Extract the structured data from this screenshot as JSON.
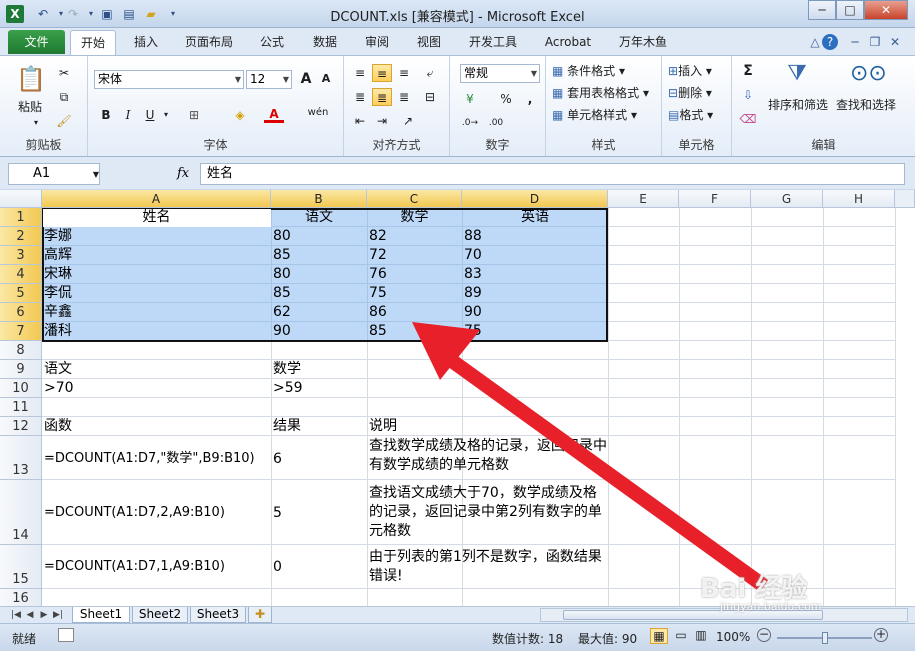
{
  "window": {
    "title": "DCOUNT.xls  [兼容模式] - Microsoft Excel",
    "app_icon": "X",
    "controls": [
      "─",
      "□",
      "✕"
    ],
    "doc_controls": [
      "△",
      "?",
      "─",
      "❐",
      "✕"
    ]
  },
  "ribbon_tabs": {
    "file": "文件",
    "tabs": [
      "开始",
      "插入",
      "页面布局",
      "公式",
      "数据",
      "审阅",
      "视图",
      "开发工具",
      "Acrobat",
      "万年木鱼"
    ],
    "active": "开始"
  },
  "ribbon": {
    "clipboard": {
      "label": "剪贴板",
      "paste": "粘贴"
    },
    "font": {
      "label": "字体",
      "font_name": "宋体",
      "font_size": "12",
      "bold": "B",
      "italic": "I",
      "underline": "U",
      "grow": "A",
      "shrink": "A",
      "wen": "wén",
      "font_color": "A"
    },
    "alignment": {
      "label": "对齐方式"
    },
    "number": {
      "label": "数字",
      "format": "常规",
      "percent": "%",
      "comma": ","
    },
    "styles": {
      "label": "样式",
      "conditional": "条件格式",
      "table": "套用表格格式",
      "cell_styles": "单元格样式"
    },
    "cells": {
      "label": "单元格",
      "insert": "插入",
      "delete": "删除",
      "format": "格式"
    },
    "editing": {
      "label": "编辑",
      "sigma": "Σ",
      "sort": "排序和筛选",
      "find": "查找和选择"
    }
  },
  "formula_bar": {
    "name_box": "A1",
    "fx": "fx",
    "content": "姓名"
  },
  "columns": [
    "A",
    "B",
    "C",
    "D",
    "E",
    "F",
    "G",
    "H"
  ],
  "rows": [
    "1",
    "2",
    "3",
    "4",
    "5",
    "6",
    "7",
    "8",
    "9",
    "10",
    "11",
    "12",
    "13",
    "14",
    "15",
    "16"
  ],
  "sheet": {
    "header": [
      "姓名",
      "语文",
      "数学",
      "英语"
    ],
    "records": [
      [
        "李娜",
        "80",
        "82",
        "88"
      ],
      [
        "高辉",
        "85",
        "72",
        "70"
      ],
      [
        "宋琳",
        "80",
        "76",
        "83"
      ],
      [
        "李侃",
        "85",
        "75",
        "89"
      ],
      [
        "辛鑫",
        "62",
        "86",
        "90"
      ],
      [
        "潘科",
        "90",
        "85",
        "75"
      ]
    ],
    "criteria_labels": [
      "语文",
      "数学"
    ],
    "criteria_values": [
      ">70",
      ">59"
    ],
    "table_headers": [
      "函数",
      "结果",
      "说明"
    ],
    "formulas": [
      {
        "formula": "=DCOUNT(A1:D7,\"数学\",B9:B10)",
        "result": "6",
        "note": "查找数学成绩及格的记录，返回记录中有数学成绩的单元格数"
      },
      {
        "formula": "=DCOUNT(A1:D7,2,A9:B10)",
        "result": "5",
        "note": "查找语文成绩大于70，数学成绩及格的记录，返回记录中第2列有数字的单元格数"
      },
      {
        "formula": "=DCOUNT(A1:D7,1,A9:B10)",
        "result": "0",
        "note": "由于列表的第1列不是数字，函数结果错误!"
      }
    ]
  },
  "sheet_tabs": [
    "Sheet1",
    "Sheet2",
    "Sheet3"
  ],
  "status": {
    "ready": "就绪",
    "count": "数值计数: 18",
    "max": "最大值: 90",
    "zoom": "100%",
    "zoom_level": 0.5
  },
  "watermark": {
    "main": "Bai 经验",
    "sub": "jingyan.baidu.com"
  }
}
